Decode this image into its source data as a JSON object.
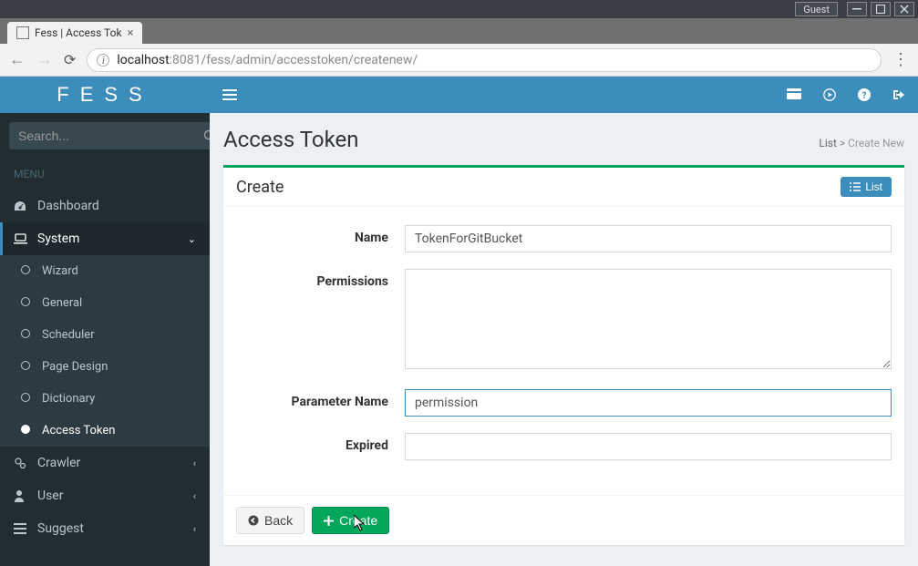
{
  "os": {
    "guest": "Guest"
  },
  "browser": {
    "tab_title": "Fess | Access Tok",
    "url_host": "localhost",
    "url_port": ":8081",
    "url_path": "/fess/admin/accesstoken/createnew/"
  },
  "logo": "FESS",
  "sidebar": {
    "search_placeholder": "Search...",
    "menu_label": "MENU",
    "items": {
      "dashboard": "Dashboard",
      "system": "System",
      "wizard": "Wizard",
      "general": "General",
      "scheduler": "Scheduler",
      "page_design": "Page Design",
      "dictionary": "Dictionary",
      "access_token": "Access Token",
      "crawler": "Crawler",
      "user": "User",
      "suggest": "Suggest"
    }
  },
  "page": {
    "title": "Access Token",
    "breadcrumb_list": "List",
    "breadcrumb_sep": ">",
    "breadcrumb_current": "Create New"
  },
  "card": {
    "title": "Create",
    "list_btn": "List"
  },
  "form": {
    "labels": {
      "name": "Name",
      "permissions": "Permissions",
      "parameter_name": "Parameter Name",
      "expired": "Expired"
    },
    "values": {
      "name": "TokenForGitBucket",
      "permissions": "",
      "parameter_name": "permission",
      "expired": ""
    }
  },
  "footer": {
    "back": "Back",
    "create": "Create"
  }
}
